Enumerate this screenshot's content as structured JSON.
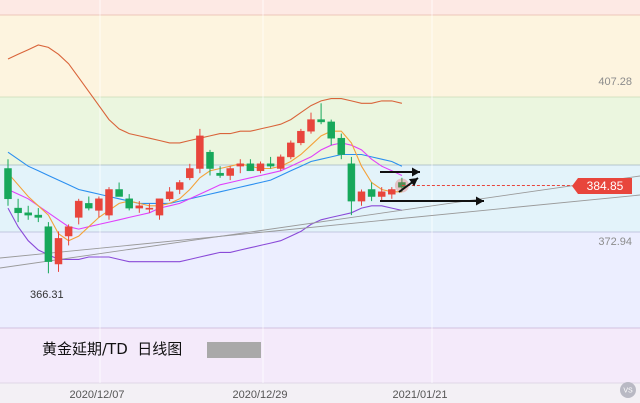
{
  "chart_data": {
    "type": "candlestick",
    "title": "黄金延期/TD  日线图",
    "x_ticks": [
      "2020/12/07",
      "2020/12/29",
      "2021/01/21"
    ],
    "price_labels": [
      {
        "text": "407.28",
        "value": 407.28
      },
      {
        "text": "372.94",
        "value": 372.94
      }
    ],
    "current_price": {
      "text": "384.85",
      "value": 384.85
    },
    "low_annotation": {
      "text": "366.31",
      "value": 366.31
    },
    "ylim": [
      358,
      422
    ],
    "colors": {
      "up": "#e8453c",
      "down": "#17a85b",
      "ma5": "#f4a23a",
      "ma10": "#e040fb",
      "ma20": "#2b8ff0",
      "boll_upper": "#d9643a",
      "boll_lower": "#8a4ad8",
      "current": "#e8453c"
    },
    "candles": [
      {
        "o": 388.5,
        "h": 390.5,
        "l": 380.5,
        "c": 382.0
      },
      {
        "o": 380.0,
        "h": 382.0,
        "l": 377.0,
        "c": 379.0
      },
      {
        "o": 379.0,
        "h": 380.5,
        "l": 377.5,
        "c": 378.5
      },
      {
        "o": 378.5,
        "h": 380.0,
        "l": 377.0,
        "c": 378.0
      },
      {
        "o": 376.0,
        "h": 377.0,
        "l": 366.0,
        "c": 368.5
      },
      {
        "o": 368.0,
        "h": 375.0,
        "l": 366.3,
        "c": 373.5
      },
      {
        "o": 374.0,
        "h": 376.5,
        "l": 372.0,
        "c": 376.0
      },
      {
        "o": 378.0,
        "h": 382.0,
        "l": 376.5,
        "c": 381.5
      },
      {
        "o": 381.0,
        "h": 382.5,
        "l": 379.5,
        "c": 380.0
      },
      {
        "o": 379.5,
        "h": 382.5,
        "l": 378.0,
        "c": 382.0
      },
      {
        "o": 378.5,
        "h": 384.5,
        "l": 377.5,
        "c": 384.0
      },
      {
        "o": 384.0,
        "h": 385.5,
        "l": 383.0,
        "c": 382.5
      },
      {
        "o": 382.0,
        "h": 383.0,
        "l": 379.5,
        "c": 380.0
      },
      {
        "o": 380.0,
        "h": 381.5,
        "l": 379.0,
        "c": 380.5
      },
      {
        "o": 380.0,
        "h": 381.0,
        "l": 379.0,
        "c": 380.0
      },
      {
        "o": 378.5,
        "h": 382.0,
        "l": 377.5,
        "c": 382.0
      },
      {
        "o": 382.0,
        "h": 384.5,
        "l": 381.5,
        "c": 383.5
      },
      {
        "o": 384.0,
        "h": 386.0,
        "l": 383.0,
        "c": 385.5
      },
      {
        "o": 386.5,
        "h": 389.5,
        "l": 386.0,
        "c": 388.5
      },
      {
        "o": 388.5,
        "h": 397.0,
        "l": 387.5,
        "c": 395.5
      },
      {
        "o": 392.0,
        "h": 392.5,
        "l": 387.0,
        "c": 388.5
      },
      {
        "o": 387.5,
        "h": 389.0,
        "l": 386.5,
        "c": 387.0
      },
      {
        "o": 387.0,
        "h": 389.0,
        "l": 386.0,
        "c": 388.5
      },
      {
        "o": 389.0,
        "h": 390.5,
        "l": 387.5,
        "c": 389.5
      },
      {
        "o": 389.5,
        "h": 390.5,
        "l": 388.0,
        "c": 388.0
      },
      {
        "o": 388.0,
        "h": 390.0,
        "l": 387.5,
        "c": 389.5
      },
      {
        "o": 389.5,
        "h": 391.0,
        "l": 388.5,
        "c": 389.0
      },
      {
        "o": 388.5,
        "h": 391.5,
        "l": 388.0,
        "c": 391.0
      },
      {
        "o": 391.0,
        "h": 394.5,
        "l": 390.5,
        "c": 394.0
      },
      {
        "o": 394.0,
        "h": 397.0,
        "l": 393.5,
        "c": 396.5
      },
      {
        "o": 396.5,
        "h": 400.5,
        "l": 396.0,
        "c": 399.0
      },
      {
        "o": 399.0,
        "h": 402.5,
        "l": 398.0,
        "c": 398.5
      },
      {
        "o": 398.5,
        "h": 399.0,
        "l": 393.5,
        "c": 395.0
      },
      {
        "o": 395.0,
        "h": 396.0,
        "l": 390.5,
        "c": 391.5
      },
      {
        "o": 389.5,
        "h": 391.0,
        "l": 378.5,
        "c": 381.5
      },
      {
        "o": 381.5,
        "h": 384.0,
        "l": 380.5,
        "c": 383.5
      },
      {
        "o": 384.0,
        "h": 385.5,
        "l": 381.5,
        "c": 382.5
      },
      {
        "o": 382.5,
        "h": 384.5,
        "l": 381.5,
        "c": 383.5
      },
      {
        "o": 383.0,
        "h": 384.5,
        "l": 382.0,
        "c": 384.0
      },
      {
        "o": 385.5,
        "h": 386.5,
        "l": 383.5,
        "c": 384.5
      }
    ],
    "ma5": [
      387.5,
      385.0,
      382.5,
      380.5,
      378.5,
      374.5,
      373.0,
      374.0,
      376.0,
      378.0,
      379.5,
      381.0,
      381.5,
      381.0,
      380.5,
      380.5,
      381.0,
      382.0,
      384.0,
      386.5,
      388.0,
      388.5,
      389.0,
      389.5,
      389.0,
      388.5,
      388.5,
      389.0,
      390.0,
      391.5,
      393.5,
      395.5,
      396.5,
      396.5,
      394.0,
      389.0,
      385.5,
      384.0,
      383.5,
      383.5
    ],
    "ma10": [
      384.0,
      383.0,
      382.0,
      380.5,
      379.0,
      377.5,
      376.0,
      375.5,
      376.0,
      376.5,
      377.0,
      377.5,
      378.0,
      378.5,
      379.0,
      380.0,
      380.5,
      381.0,
      382.0,
      383.0,
      384.0,
      385.0,
      385.5,
      386.0,
      386.5,
      387.0,
      387.5,
      388.0,
      389.0,
      390.0,
      391.0,
      392.5,
      393.5,
      394.0,
      393.5,
      392.5,
      390.5,
      389.0,
      388.0,
      387.0
    ],
    "ma20": [
      392.0,
      390.5,
      389.0,
      388.0,
      387.0,
      386.0,
      385.0,
      384.0,
      383.5,
      383.0,
      382.5,
      382.0,
      381.5,
      381.0,
      381.0,
      381.0,
      381.0,
      381.5,
      382.0,
      382.5,
      383.0,
      383.5,
      384.0,
      384.5,
      385.0,
      385.5,
      386.0,
      387.0,
      388.0,
      389.0,
      390.0,
      390.5,
      391.0,
      391.5,
      391.5,
      391.5,
      391.0,
      390.5,
      390.0,
      389.0
    ],
    "boll_upper": [
      412.0,
      413.0,
      414.0,
      415.0,
      414.5,
      413.0,
      411.0,
      408.0,
      405.0,
      402.0,
      399.0,
      397.0,
      396.0,
      395.5,
      395.0,
      394.5,
      394.0,
      394.0,
      394.5,
      395.0,
      395.5,
      396.0,
      396.0,
      396.5,
      396.5,
      397.0,
      397.5,
      398.0,
      399.0,
      400.5,
      402.0,
      403.0,
      403.5,
      403.5,
      403.0,
      402.5,
      402.5,
      403.0,
      403.0,
      402.5
    ],
    "boll_lower": [
      380.0,
      376.0,
      373.0,
      371.0,
      370.0,
      369.0,
      369.0,
      369.0,
      369.5,
      369.5,
      369.5,
      369.0,
      368.5,
      368.5,
      368.5,
      368.5,
      368.5,
      368.5,
      369.0,
      369.5,
      370.0,
      370.5,
      370.5,
      371.0,
      371.5,
      372.0,
      372.5,
      373.0,
      374.0,
      375.0,
      376.5,
      377.5,
      378.0,
      378.5,
      379.0,
      380.0,
      380.5,
      380.5,
      380.0,
      379.5
    ]
  }
}
